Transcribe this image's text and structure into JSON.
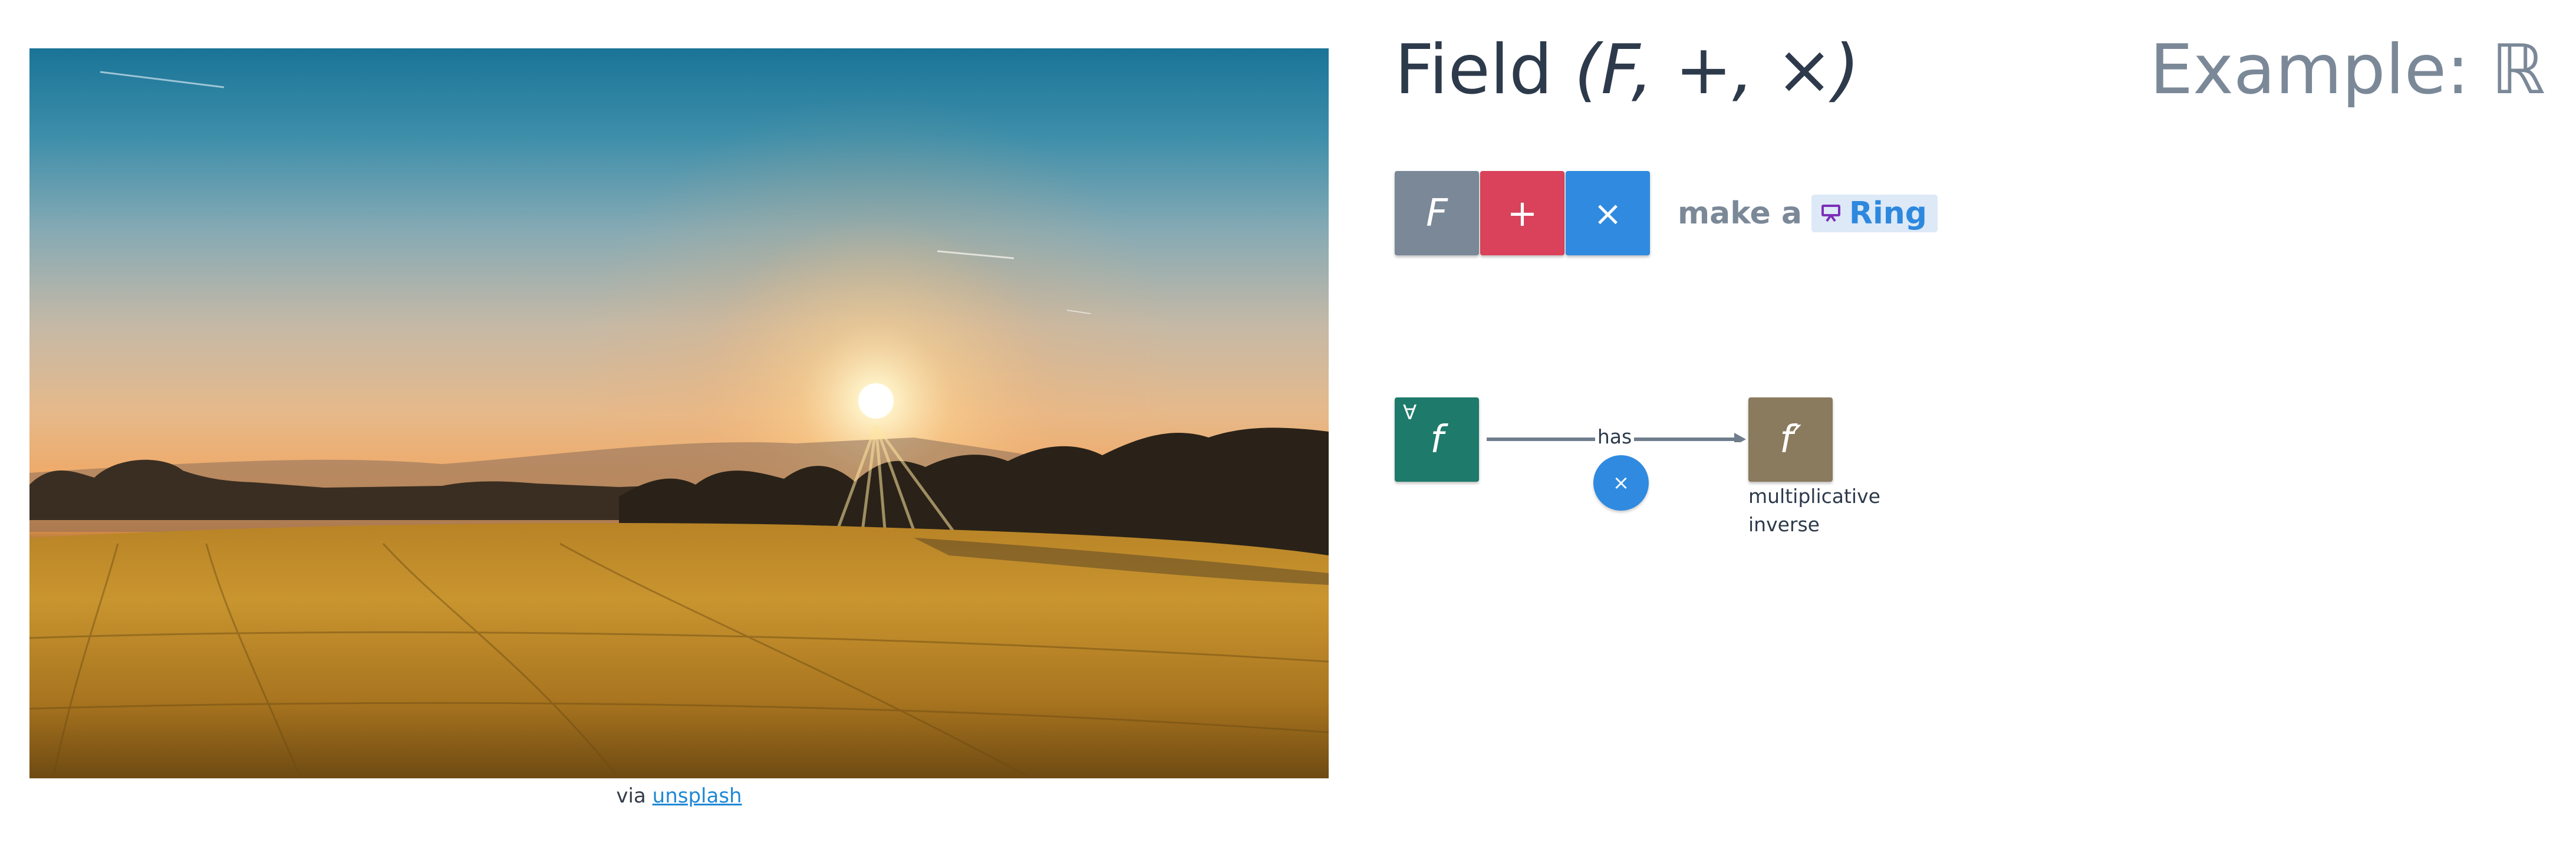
{
  "photo": {
    "caption_prefix": "via",
    "caption_link": "unsplash"
  },
  "title": {
    "word": "Field",
    "signature": "(F, +, ×)"
  },
  "example": "Example: ℝ",
  "structure": {
    "set": "F",
    "op_add": "+",
    "op_mul": "×",
    "makes_prefix": "make a",
    "ring_label": "Ring",
    "ring_icon": "presentation-icon"
  },
  "axiom": {
    "quantifier": "∀",
    "variable": "f",
    "relation": "has",
    "operation": "×",
    "result": "f′",
    "result_label": "multiplicative inverse"
  },
  "colors": {
    "set": "#7a8898",
    "add": "#d9425a",
    "mul": "#2f8ae0",
    "variable": "#1e7a6a",
    "result": "#8a7a5e",
    "link": "#1e88d6"
  }
}
